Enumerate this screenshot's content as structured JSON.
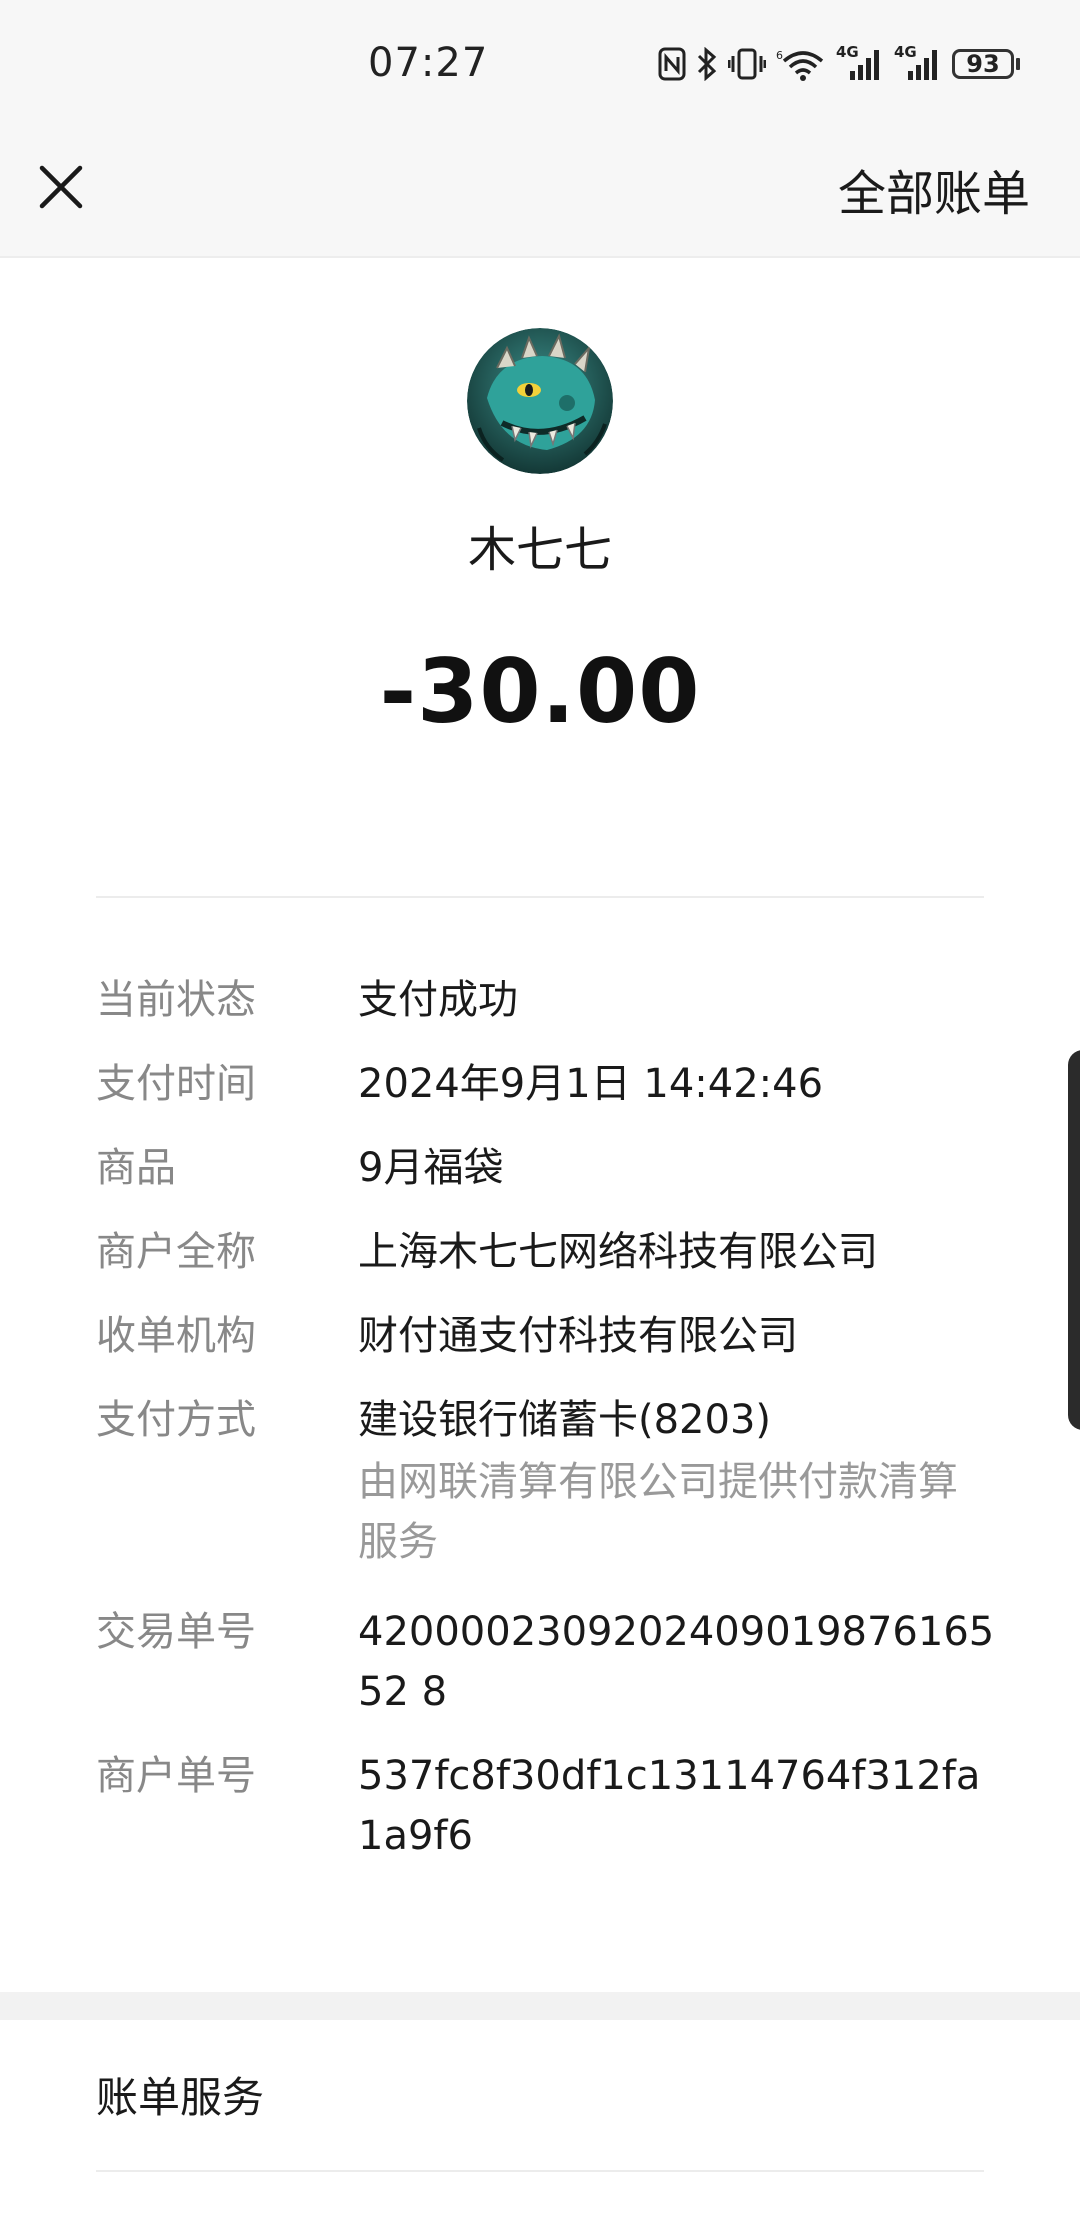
{
  "status_bar": {
    "time": "07:27",
    "battery": "93",
    "network_labels": [
      "4G",
      "4G"
    ],
    "icons": [
      "nfc-icon",
      "bluetooth-icon",
      "vibrate-icon",
      "wifi-icon",
      "signal-icon",
      "signal-icon",
      "battery-icon"
    ]
  },
  "nav": {
    "close_icon": "close-icon",
    "all_bills": "全部账单"
  },
  "header": {
    "payee": "木七七",
    "amount": "-30.00",
    "avatar_icon": "dragon-avatar"
  },
  "details": {
    "status": {
      "label": "当前状态",
      "value": "支付成功"
    },
    "time": {
      "label": "支付时间",
      "value": "2024年9月1日 14:42:46"
    },
    "product": {
      "label": "商品",
      "value": "9月福袋"
    },
    "merchant_name": {
      "label": "商户全称",
      "value": "上海木七七网络科技有限公司"
    },
    "acquirer": {
      "label": "收单机构",
      "value": "财付通支付科技有限公司"
    },
    "pay_method": {
      "label": "支付方式",
      "value": "建设银行储蓄卡(8203)",
      "note": "由网联清算有限公司提供付款清算服务"
    },
    "transaction_no": {
      "label": "交易单号",
      "value": "420000230920240901987616552 8"
    },
    "merchant_order_no": {
      "label": "商户单号",
      "value": "537fc8f30df1c13114764f312fa1a9f6"
    }
  },
  "footer": {
    "bill_service": "账单服务"
  },
  "colors": {
    "label_gray": "#888888",
    "note_gray": "#999999",
    "text_dark": "#1a1a1a",
    "bar_bg": "#f7f7f7"
  }
}
